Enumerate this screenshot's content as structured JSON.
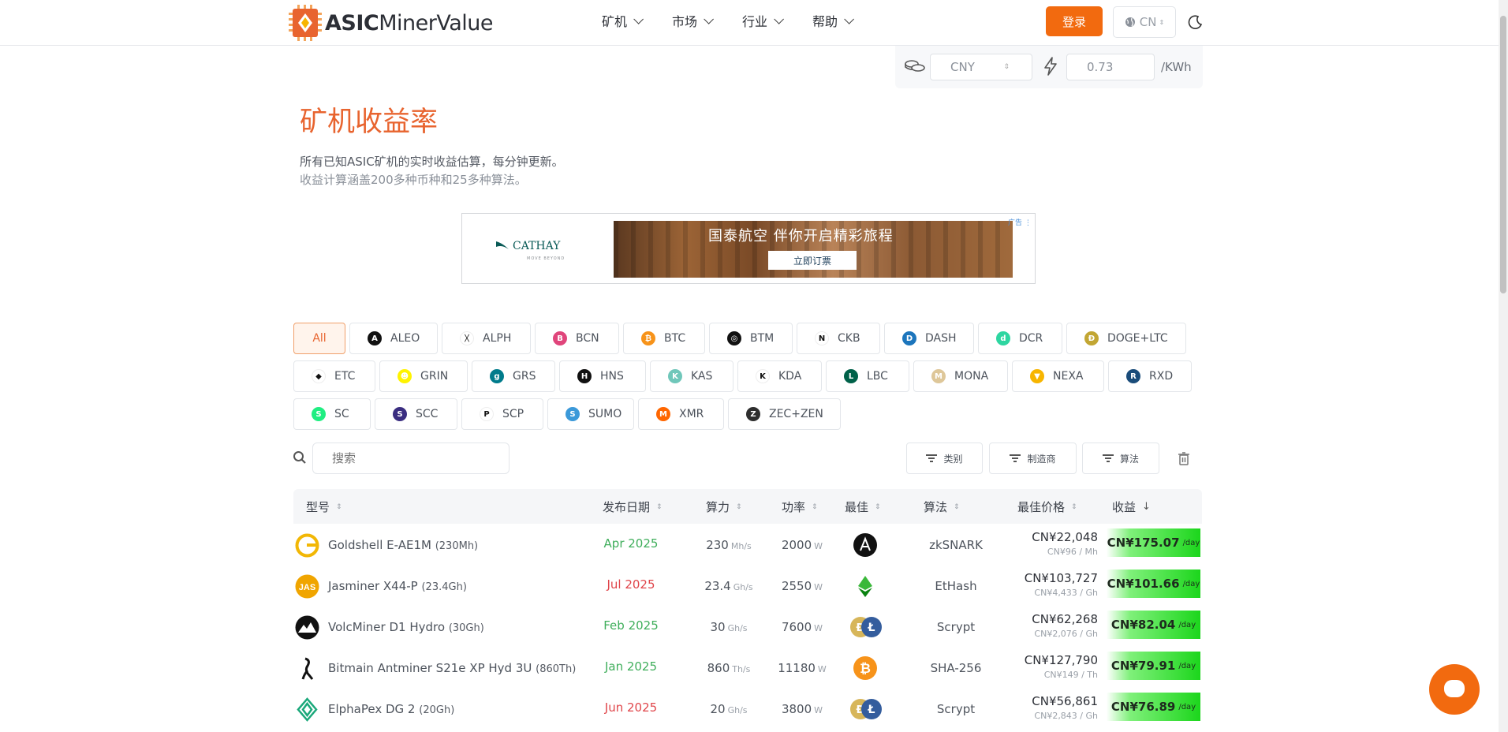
{
  "header": {
    "logo_bold": "ASIC",
    "logo_light": "MinerValue",
    "nav": [
      {
        "label": "矿机"
      },
      {
        "label": "市场"
      },
      {
        "label": "行业"
      },
      {
        "label": "帮助"
      }
    ],
    "login_label": "登录",
    "lang_label": "CN"
  },
  "settings": {
    "currency": "CNY",
    "electricity_price": "0.73",
    "unit": "/KWh"
  },
  "page": {
    "title": "矿机收益率",
    "desc1": "所有已知ASIC矿机的实时收益估算，每分钟更新。",
    "desc2": "收益计算涵盖200多种币种和25多种算法。"
  },
  "ad": {
    "brand": "CATHAY",
    "tagline": "MOVE BEYOND",
    "headline": "国泰航空 伴你开启精彩旅程",
    "cta": "立即订票",
    "badge": "广告"
  },
  "coins": [
    {
      "label": "All",
      "color": "",
      "active": true
    },
    {
      "label": "ALEO",
      "color": "#111111",
      "glyph": "A"
    },
    {
      "label": "ALPH",
      "color": "#ffffff",
      "glyph": "ᚷ"
    },
    {
      "label": "BCN",
      "color": "#e0457b",
      "glyph": "B"
    },
    {
      "label": "BTC",
      "color": "#f7931a",
      "glyph": "₿"
    },
    {
      "label": "BTM",
      "color": "#111111",
      "glyph": "◎"
    },
    {
      "label": "CKB",
      "color": "#ffffff",
      "glyph": "N"
    },
    {
      "label": "DASH",
      "color": "#1c75bc",
      "glyph": "D"
    },
    {
      "label": "DCR",
      "color": "#2ed6a1",
      "glyph": "d"
    },
    {
      "label": "DOGE+LTC",
      "color": "#c2a633",
      "glyph": "Ð"
    },
    {
      "label": "ETC",
      "color": "#ffffff",
      "glyph": "◆"
    },
    {
      "label": "GRIN",
      "color": "#fff300",
      "glyph": "☻"
    },
    {
      "label": "GRS",
      "color": "#007b8b",
      "glyph": "g"
    },
    {
      "label": "HNS",
      "color": "#111111",
      "glyph": "H"
    },
    {
      "label": "KAS",
      "color": "#70c7ba",
      "glyph": "K"
    },
    {
      "label": "KDA",
      "color": "#ffffff",
      "glyph": "K"
    },
    {
      "label": "LBC",
      "color": "#006149",
      "glyph": "L"
    },
    {
      "label": "MONA",
      "color": "#dec799",
      "glyph": "M"
    },
    {
      "label": "NEXA",
      "color": "#f7b500",
      "glyph": "▼"
    },
    {
      "label": "RXD",
      "color": "#1a4c7a",
      "glyph": "R"
    },
    {
      "label": "SC",
      "color": "#20ee82",
      "glyph": "S"
    },
    {
      "label": "SCC",
      "color": "#3a2d80",
      "glyph": "S"
    },
    {
      "label": "SCP",
      "color": "#ffffff",
      "glyph": "P"
    },
    {
      "label": "SUMO",
      "color": "#3b99d9",
      "glyph": "S"
    },
    {
      "label": "XMR",
      "color": "#ff6600",
      "glyph": "M"
    },
    {
      "label": "ZEC+ZEN",
      "color": "#2e2e2e",
      "glyph": "Z"
    }
  ],
  "toolbar": {
    "search_placeholder": "搜索",
    "filter_category": "类别",
    "filter_manufacturer": "制造商",
    "filter_algorithm": "算法"
  },
  "table": {
    "headers": {
      "model": "型号",
      "release": "发布日期",
      "hashrate": "算力",
      "power": "功率",
      "best": "最佳",
      "algorithm": "算法",
      "best_price": "最佳价格",
      "profit": "收益"
    },
    "rows": [
      {
        "name": "Goldshell E-AE1M",
        "spec": "(230Mh)",
        "release": "Apr 2025",
        "release_color": "#3fae5b",
        "hashrate": "230",
        "hash_unit": "Mh/s",
        "power": "2000",
        "power_unit": "W",
        "algorithm": "zkSNARK",
        "price": "CN¥22,048",
        "price_sub": "CN¥96 / Mh",
        "profit": "CN¥175.07",
        "profit_unit": "/day",
        "coin": "aleo"
      },
      {
        "name": "Jasminer X44-P",
        "spec": "(23.4Gh)",
        "release": "Jul 2025",
        "release_color": "#e0454a",
        "hashrate": "23.4",
        "hash_unit": "Gh/s",
        "power": "2550",
        "power_unit": "W",
        "algorithm": "EtHash",
        "price": "CN¥103,727",
        "price_sub": "CN¥4,433 / Gh",
        "profit": "CN¥101.66",
        "profit_unit": "/day",
        "coin": "etc"
      },
      {
        "name": "VolcMiner D1 Hydro",
        "spec": "(30Gh)",
        "release": "Feb 2025",
        "release_color": "#3fae5b",
        "hashrate": "30",
        "hash_unit": "Gh/s",
        "power": "7600",
        "power_unit": "W",
        "algorithm": "Scrypt",
        "price": "CN¥62,268",
        "price_sub": "CN¥2,076 / Gh",
        "profit": "CN¥82.04",
        "profit_unit": "/day",
        "coin": "dogeltc"
      },
      {
        "name": "Bitmain Antminer S21e XP Hyd 3U",
        "spec": "(860Th)",
        "release": "Jan 2025",
        "release_color": "#3fae5b",
        "hashrate": "860",
        "hash_unit": "Th/s",
        "power": "11180",
        "power_unit": "W",
        "algorithm": "SHA-256",
        "price": "CN¥127,790",
        "price_sub": "CN¥149 / Th",
        "profit": "CN¥79.91",
        "profit_unit": "/day",
        "coin": "btc"
      },
      {
        "name": "ElphaPex DG 2",
        "spec": "(20Gh)",
        "release": "Jun 2025",
        "release_color": "#e0454a",
        "hashrate": "20",
        "hash_unit": "Gh/s",
        "power": "3800",
        "power_unit": "W",
        "algorithm": "Scrypt",
        "price": "CN¥56,861",
        "price_sub": "CN¥2,843 / Gh",
        "profit": "CN¥76.89",
        "profit_unit": "/day",
        "coin": "dogeltc"
      }
    ]
  },
  "colors": {
    "accent": "#f26a0f",
    "title": "#e8642f"
  }
}
